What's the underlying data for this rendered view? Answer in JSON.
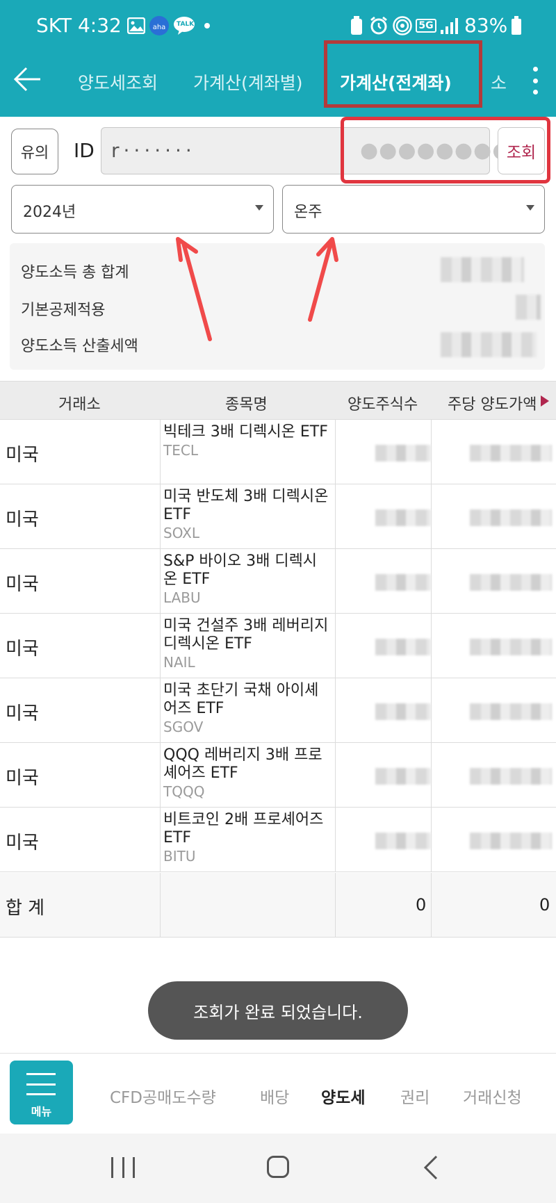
{
  "status_bar": {
    "carrier_time": "SKT 4:32",
    "battery": "83%",
    "kakao_talk": "TALK",
    "network": "5G"
  },
  "tabs": [
    {
      "label": "양도세조회"
    },
    {
      "label": "가계산(계좌별)"
    },
    {
      "label": "가계산(전계좌)"
    },
    {
      "label": "소"
    }
  ],
  "form": {
    "notice_label": "유의",
    "id_label": "ID",
    "id_value": "r·······",
    "password_value": "●●●●●●●●",
    "query_label": "조회",
    "year_select": "2024년",
    "account_select": "온주"
  },
  "summary": {
    "rows": [
      {
        "label": "양도소득 총 합계"
      },
      {
        "label": "기본공제적용"
      },
      {
        "label": "양도소득 산출세액"
      }
    ]
  },
  "table": {
    "headers": [
      "거래소",
      "종목명",
      "양도주식수",
      "주당 양도가액"
    ],
    "rows": [
      {
        "exchange": "미국",
        "name": "빅테크 3배 디렉시온 ETF",
        "ticker": "TECL"
      },
      {
        "exchange": "미국",
        "name": "미국 반도체 3배 디렉시온 ETF",
        "ticker": "SOXL"
      },
      {
        "exchange": "미국",
        "name": "S&P 바이오 3배 디렉시온 ETF",
        "ticker": "LABU"
      },
      {
        "exchange": "미국",
        "name": "미국 건설주 3배 레버리지 디렉시온 ETF",
        "ticker": "NAIL"
      },
      {
        "exchange": "미국",
        "name": "미국 초단기 국채 아이셰어즈 ETF",
        "ticker": "SGOV"
      },
      {
        "exchange": "미국",
        "name": "QQQ 레버리지 3배 프로셰어즈 ETF",
        "ticker": "TQQQ"
      },
      {
        "exchange": "미국",
        "name": "비트코인 2배 프로셰어즈 ETF",
        "ticker": "BITU"
      }
    ],
    "total": {
      "label": "합 계",
      "shares": "0",
      "price": "0"
    }
  },
  "toast": "조회가 완료 되었습니다.",
  "bottom_menu": {
    "menu_label": "메뉴",
    "items": [
      {
        "label": "CFD공매도수량",
        "active": false
      },
      {
        "label": "배당",
        "active": false
      },
      {
        "label": "양도세",
        "active": true
      },
      {
        "label": "권리",
        "active": false
      },
      {
        "label": "거래신청",
        "active": false
      }
    ]
  },
  "colors": {
    "header_teal": "#1aa9b8",
    "annotation_red": "#e0353f",
    "query_magenta": "#b0264e"
  }
}
